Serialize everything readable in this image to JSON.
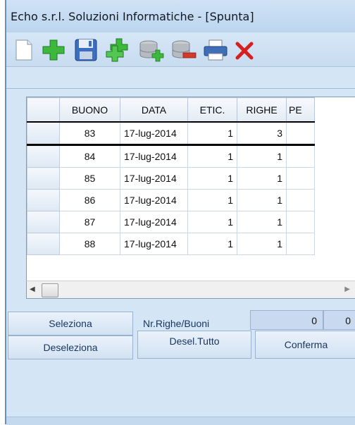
{
  "window": {
    "title": "Echo s.r.l. Soluzioni Informatiche - [Spunta]"
  },
  "toolbar": {
    "icons": [
      "new-document-icon",
      "add-icon",
      "save-icon",
      "add-multiple-icon",
      "database-add-icon",
      "database-remove-icon",
      "print-icon",
      "close-icon"
    ]
  },
  "grid": {
    "columns": [
      "BUONO",
      "DATA",
      "ETIC.",
      "RIGHE",
      "PE"
    ],
    "rows": [
      {
        "buono": "83",
        "data": "17-lug-2014",
        "etic": "1",
        "righe": "3"
      },
      {
        "buono": "84",
        "data": "17-lug-2014",
        "etic": "1",
        "righe": "1"
      },
      {
        "buono": "85",
        "data": "17-lug-2014",
        "etic": "1",
        "righe": "1"
      },
      {
        "buono": "86",
        "data": "17-lug-2014",
        "etic": "1",
        "righe": "1"
      },
      {
        "buono": "87",
        "data": "17-lug-2014",
        "etic": "1",
        "righe": "1"
      },
      {
        "buono": "88",
        "data": "17-lug-2014",
        "etic": "1",
        "righe": "1"
      }
    ]
  },
  "controls": {
    "seleziona": "Seleziona",
    "deseleziona": "Deseleziona",
    "nr_label": "Nr.Righe/Buoni",
    "nr_righe": "0",
    "nr_buoni": "0",
    "desel_tutto": "Desel.Tutto",
    "conferma": "Conferma"
  },
  "colors": {
    "accent": "#17355f",
    "background": "#d4e5f6"
  }
}
